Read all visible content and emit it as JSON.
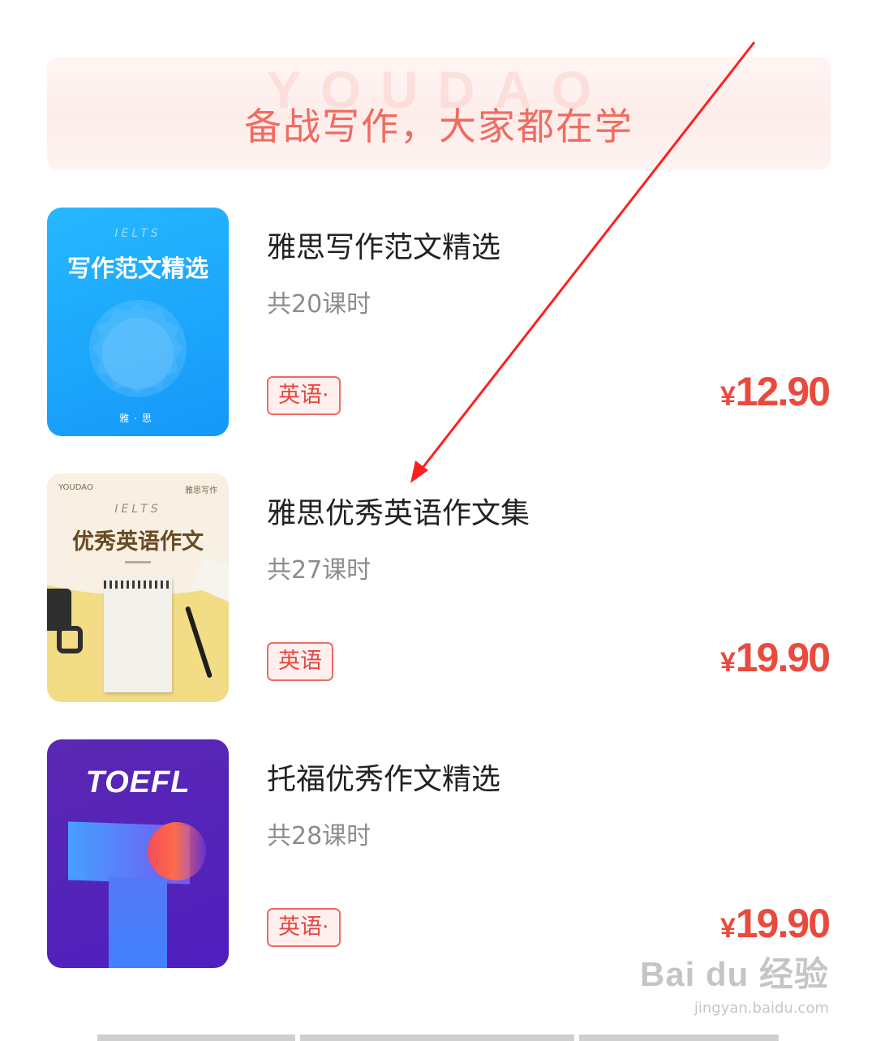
{
  "banner": {
    "watermark": "YOUDAO",
    "title": "备战写作，大家都在学"
  },
  "courses": [
    {
      "title": "雅思写作范文精选",
      "lessons": "共20课时",
      "tag": "英语·",
      "price": "12.90",
      "currency": "¥",
      "cover": {
        "label_top": "IELTS",
        "title": "写作范文精选",
        "footer": "雅·思",
        "color": "#1aa6fb"
      }
    },
    {
      "title": "雅思优秀英语作文集",
      "lessons": "共27课时",
      "tag": "英语",
      "price": "19.90",
      "currency": "¥",
      "cover": {
        "brand": "YOUDAO",
        "series": "雅思写作",
        "label_top": "IELTS",
        "title": "优秀英语作文",
        "color": "#f3dc86"
      }
    },
    {
      "title": "托福优秀作文精选",
      "lessons": "共28课时",
      "tag": "英语·",
      "price": "19.90",
      "currency": "¥",
      "cover": {
        "title": "TOEFL",
        "color": "#5424b8"
      }
    }
  ],
  "annotation": {
    "arrow_color": "#ff1f1f"
  },
  "watermark": {
    "brand": "Bai du 经验",
    "site": "jingyan.baidu.com"
  },
  "accent_color": "#ea4a3d"
}
